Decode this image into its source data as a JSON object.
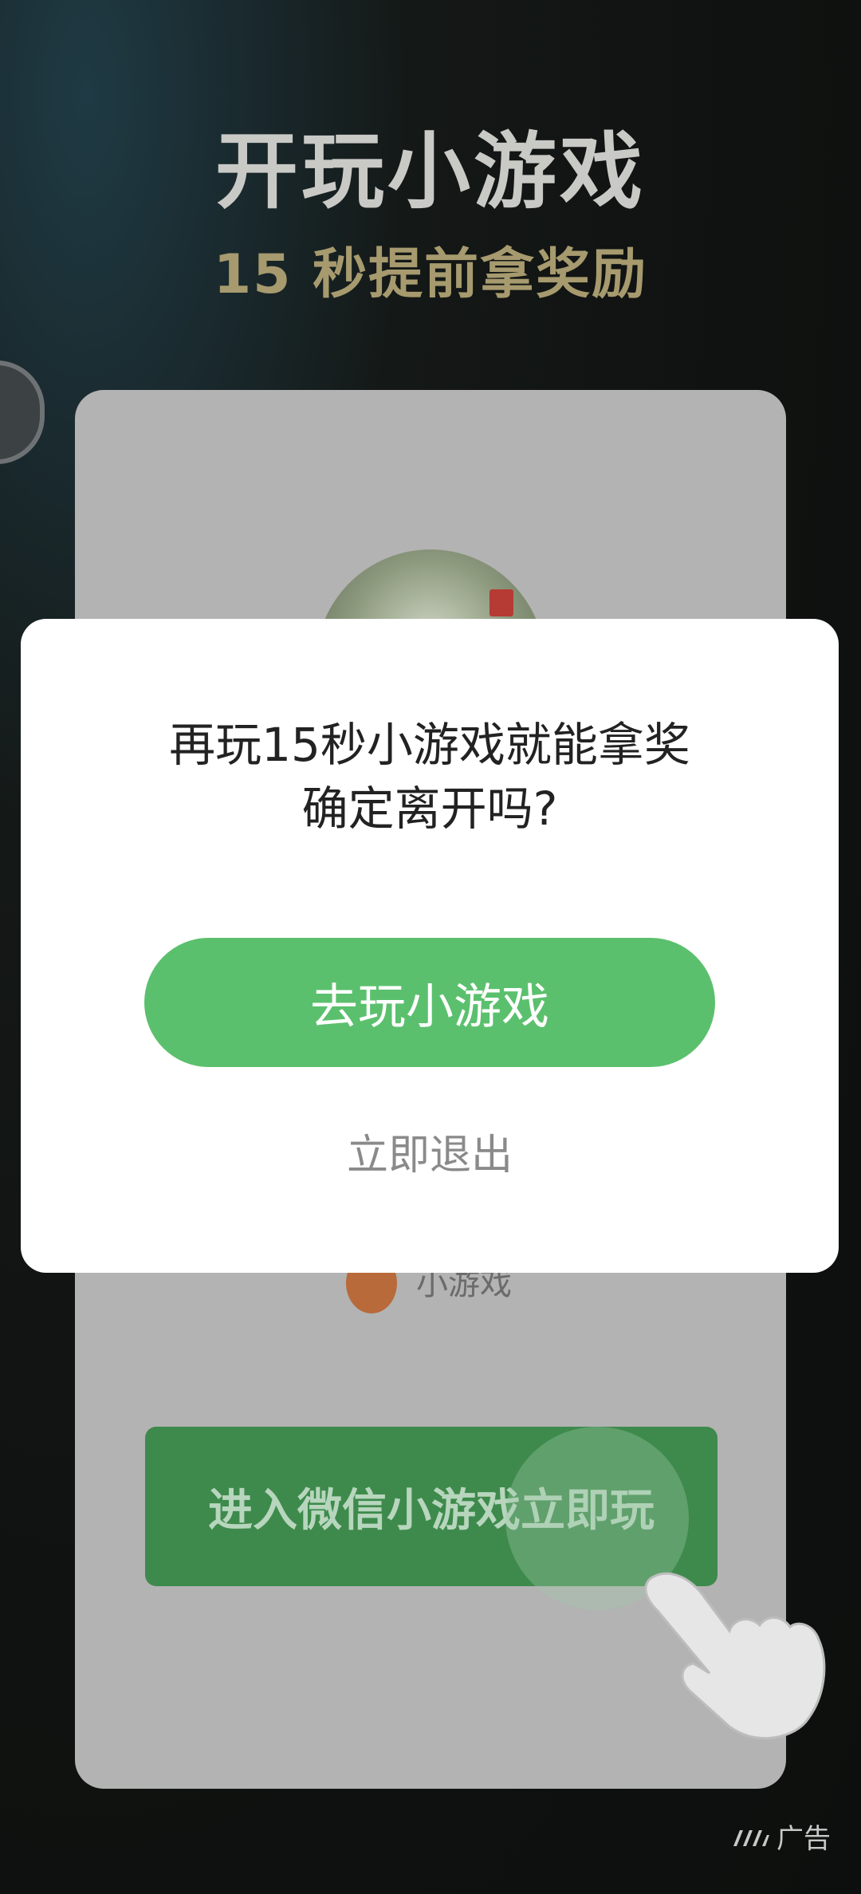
{
  "header": {
    "title": "开玩小游戏",
    "subtitle": "15 秒提前拿奖励"
  },
  "card": {
    "minigame_label": "小游戏",
    "enter_button": "进入微信小游戏立即玩"
  },
  "dialog": {
    "message_line1": "再玩15秒小游戏就能拿奖",
    "message_line2": "确定离开吗?",
    "primary_button": "去玩小游戏",
    "secondary_link": "立即退出"
  },
  "ad": {
    "label": "广告"
  },
  "colors": {
    "primary_green": "#5bc06d",
    "subtitle_gold": "#a69a6e"
  }
}
